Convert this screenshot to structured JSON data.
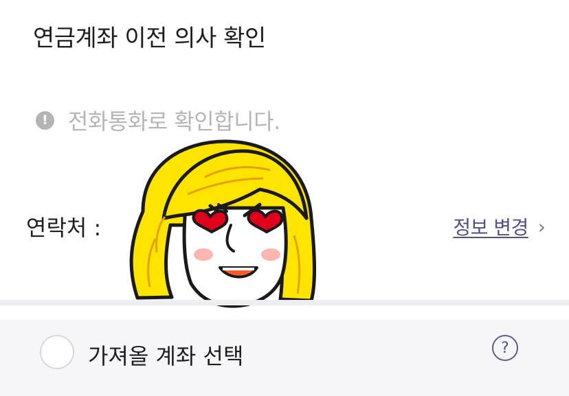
{
  "header": {
    "title": "연금계좌 이전 의사 확인"
  },
  "notice": {
    "icon": "exclamation-icon",
    "icon_glyph": "!",
    "text": "전화통화로 확인합니다."
  },
  "contact": {
    "label": "연락처 :",
    "change_link": "정보 변경",
    "chevron_glyph": "›"
  },
  "sticker": {
    "description_name": "blonde-character-heart-eyes-sticker"
  },
  "account_select": {
    "label": "가져올 계좌 선택",
    "selected": false,
    "help_glyph": "?"
  },
  "colors": {
    "title_text": "#1e1e1e",
    "muted_text": "#b5b5b5",
    "link": "#4f4f8a",
    "row_background": "#f6f6f9"
  }
}
